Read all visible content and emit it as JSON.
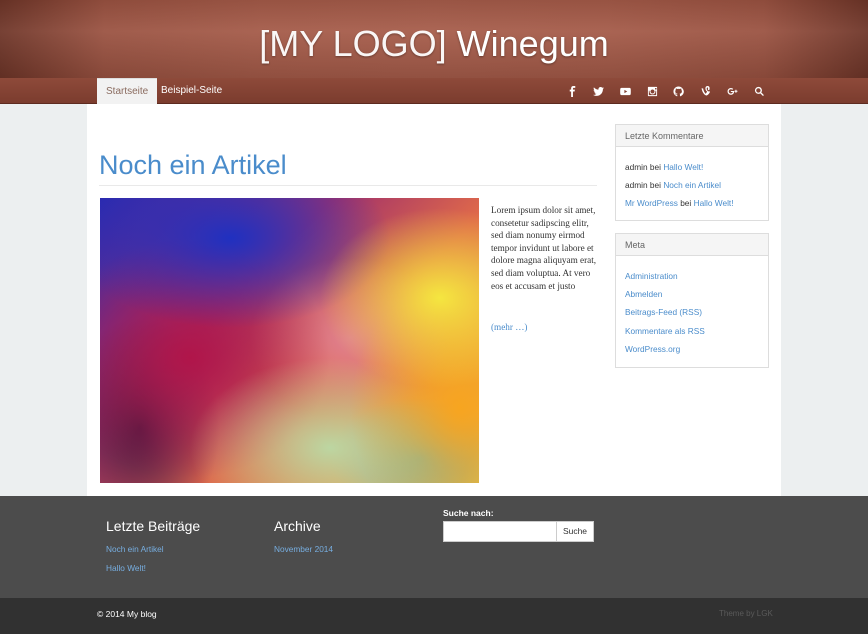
{
  "header": {
    "logo_light": "[MY LOGO]",
    "logo_bold": "Winegum"
  },
  "nav": {
    "items": [
      {
        "label": "Startseite",
        "active": true
      },
      {
        "label": "Beispiel-Seite",
        "active": false
      }
    ],
    "social_icons": [
      "facebook-icon",
      "twitter-icon",
      "youtube-icon",
      "instagram-icon",
      "github-icon",
      "vine-icon",
      "google-plus-icon",
      "search-icon"
    ]
  },
  "post": {
    "title": "Noch ein Artikel",
    "excerpt": "Lorem ipsum dolor sit amet, consetetur sadipscing elitr, sed diam nonumy eirmod tempor invidunt ut labore et dolore magna aliquyam erat, sed diam voluptua. At vero eos et accusam et justo",
    "more": "(mehr …)"
  },
  "sidebar": {
    "comments": {
      "title": "Letzte Kommentare",
      "items": [
        {
          "author": "admin",
          "sep": "bei",
          "post": "Hallo Welt!"
        },
        {
          "author": "admin",
          "sep": "bei",
          "post": "Noch ein Artikel"
        },
        {
          "author": "Mr WordPress",
          "sep": "bei",
          "post": "Hallo Welt!"
        }
      ]
    },
    "meta": {
      "title": "Meta",
      "items": [
        "Administration",
        "Abmelden",
        "Beitrags-Feed (RSS)",
        "Kommentare als RSS",
        "WordPress.org"
      ]
    }
  },
  "footer": {
    "recent_title": "Letzte Beiträge",
    "recent_items": [
      "Noch ein Artikel",
      "Hallo Welt!"
    ],
    "archive_title": "Archive",
    "archive_items": [
      "November 2014"
    ],
    "search_label": "Suche nach:",
    "search_value": "",
    "search_button": "Suche"
  },
  "bottom": {
    "copyright": "© 2014 My blog",
    "theme_by": "Theme by LGK"
  },
  "colors": {
    "accent": "#4a8ccb",
    "header": "#a45a48",
    "footer": "#4c4c4c",
    "bottom_bar": "#313131"
  }
}
